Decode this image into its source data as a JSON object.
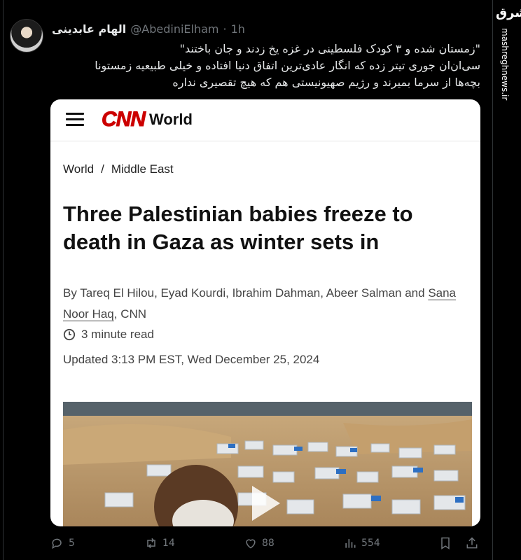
{
  "tweet": {
    "author_name": "الهام عابدینی",
    "handle": "@AbediniElham",
    "separator": "·",
    "time": "1h",
    "text_lines": [
      "\"زمستان شده و ۳ کودک فلسطینی در غزه یخ زدند و جان باختند\"",
      "سی‌ان‌ان جوری تیتر زده که انگار عادی‌ترین اتفاق دنیا افتاده و خیلی طبیعیه زمستونا",
      "بچه‌ها از سرما بمیرند و رژیم صهیونیستی هم که هیچ تقصیری نداره"
    ]
  },
  "watermark": {
    "logo_text": "مشرق",
    "site": "mashreghnews.ir"
  },
  "card": {
    "logo": "CNN",
    "section": "World",
    "breadcrumb": [
      "World",
      "/",
      "Middle East"
    ],
    "headline": "Three Palestinian babies freeze to death in Gaza as winter sets in",
    "byline_prefix": "By Tareq El Hilou, Eyad Kourdi, Ibrahim Dahman, Abeer Salman and ",
    "byline_link": "Sana Noor Haq",
    "byline_suffix": ", CNN",
    "read_time": "3 minute read",
    "updated": "Updated 3:13 PM EST, Wed December 25, 2024"
  },
  "actions": {
    "replies": "5",
    "reposts": "14",
    "likes": "88",
    "views": "554"
  },
  "colors": {
    "background": "#000000",
    "muted": "#71767b",
    "cnn_red": "#cc0000"
  }
}
